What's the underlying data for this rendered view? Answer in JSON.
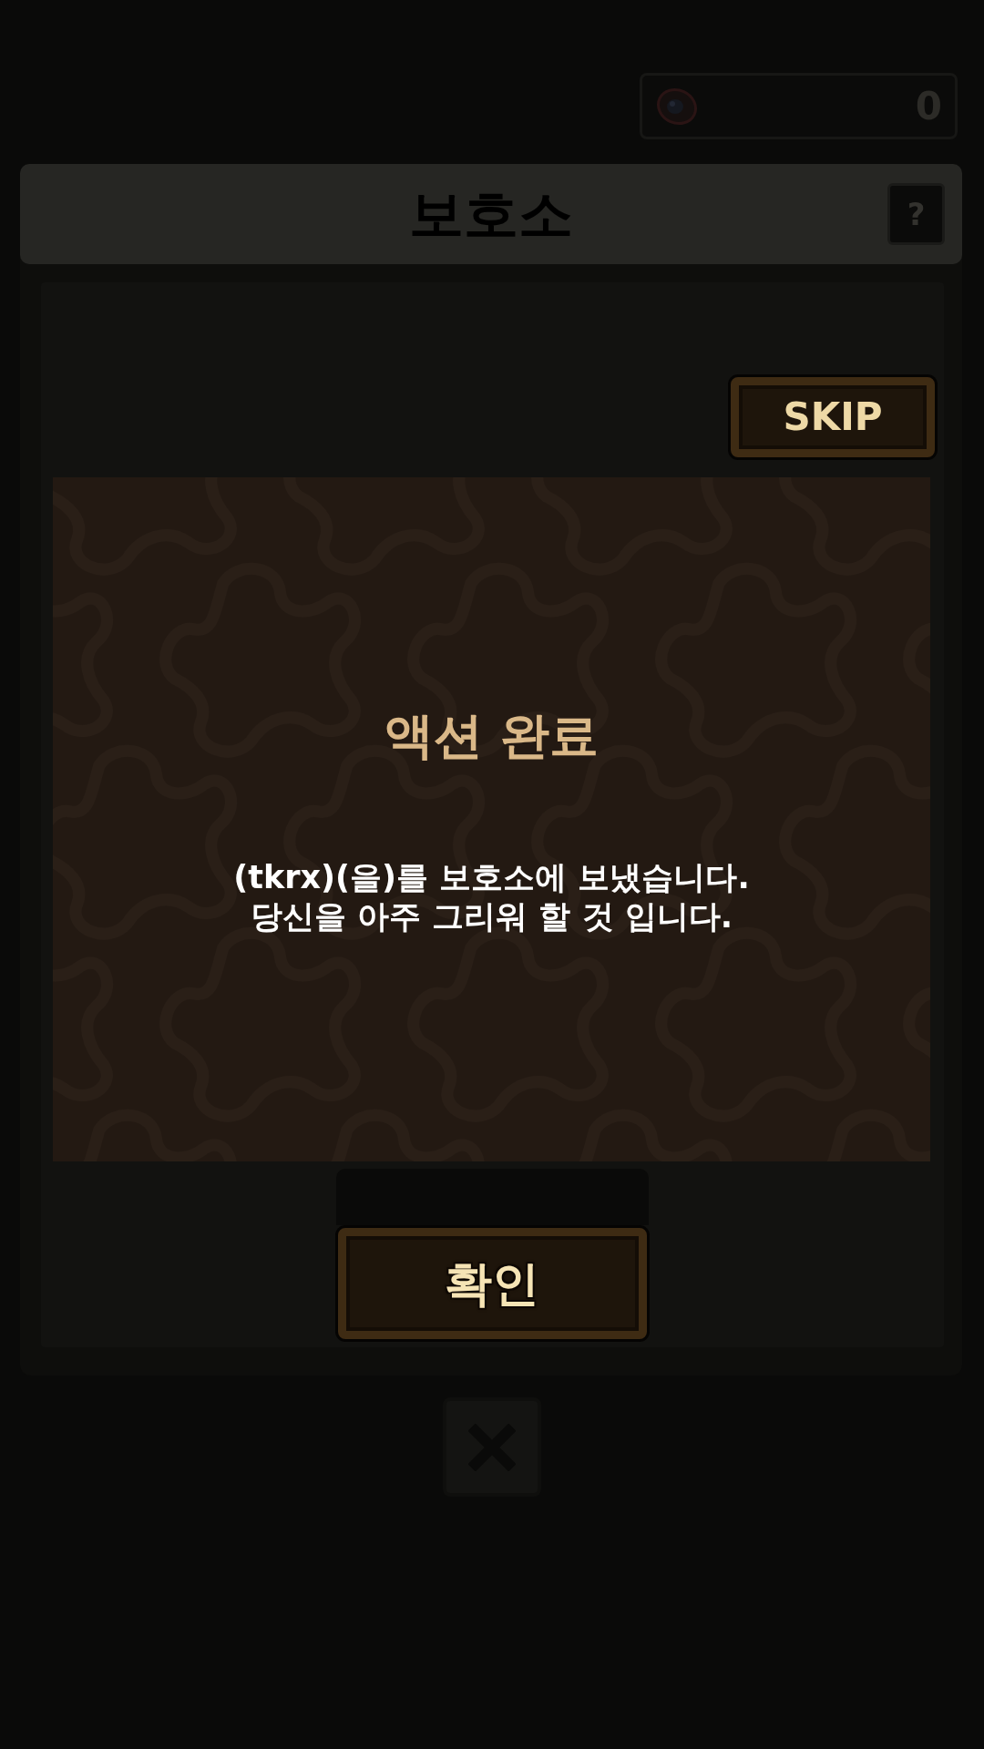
{
  "currency": {
    "amount": "0"
  },
  "header": {
    "title": "보호소",
    "help_button": "?"
  },
  "skip_button": {
    "label": "SKIP"
  },
  "dialog": {
    "title": "액션 완료",
    "message": "(tkrx)(을)를 보호소에 보냈습니다.\n당신을 아주 그리워 할 것 입니다.",
    "confirm_button": "확인"
  }
}
